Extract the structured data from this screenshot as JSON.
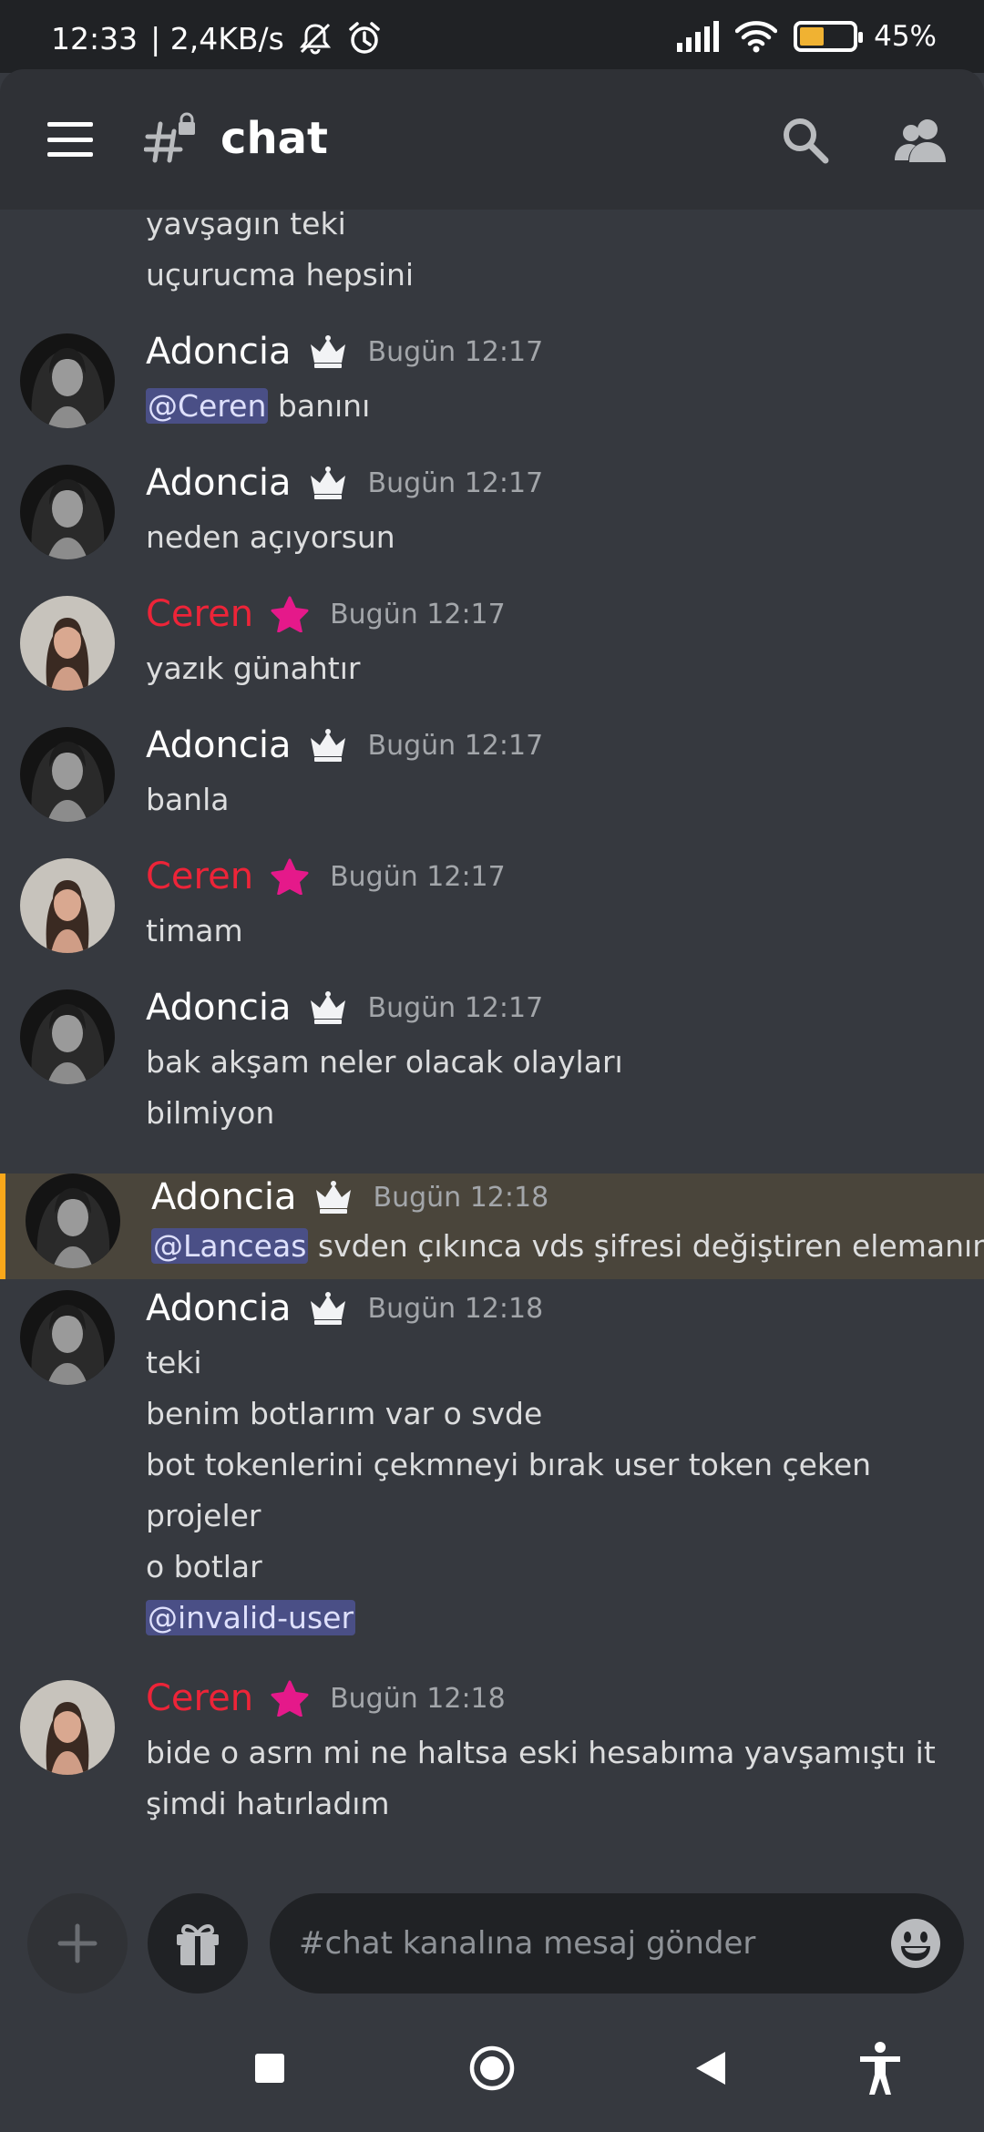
{
  "status_bar": {
    "time": "12:33",
    "network_speed": "| 2,4KB/s",
    "battery": "45%",
    "battery_level": 0.45
  },
  "header": {
    "channel_name": "chat",
    "icons": [
      "menu-icon",
      "locked-channel-hash-icon",
      "search-icon",
      "members-icon"
    ]
  },
  "colors": {
    "background": "#36393f",
    "header": "#2f3136",
    "mention_bg": "#4a4f86",
    "highlight_bg": "#4a453b",
    "highlight_bar": "#faa81a",
    "ceren_name": "#ed2438",
    "star_badge": "#e5198a"
  },
  "messages": [
    {
      "continuation": true,
      "lines": [
        {
          "text": "yavşagın teki"
        },
        {
          "text": "uçurucma hepsini"
        }
      ]
    },
    {
      "author": "Adoncia",
      "badge": "crown-icon",
      "time": "Bugün 12:17",
      "lines": [
        {
          "mention": "@Ceren",
          "text": " banını"
        }
      ]
    },
    {
      "author": "Adoncia",
      "badge": "crown-icon",
      "time": "Bugün 12:17",
      "lines": [
        {
          "text": "neden açıyorsun"
        }
      ]
    },
    {
      "author": "Ceren",
      "badge": "star-icon",
      "time": "Bugün 12:17",
      "lines": [
        {
          "text": "yazık günahtır"
        }
      ]
    },
    {
      "author": "Adoncia",
      "badge": "crown-icon",
      "time": "Bugün 12:17",
      "lines": [
        {
          "text": "banla"
        }
      ]
    },
    {
      "author": "Ceren",
      "badge": "star-icon",
      "time": "Bugün 12:17",
      "lines": [
        {
          "text": "timam"
        }
      ]
    },
    {
      "author": "Adoncia",
      "badge": "crown-icon",
      "time": "Bugün 12:17",
      "lines": [
        {
          "text": "bak akşam neler olacak olayları"
        },
        {
          "text": "bilmiyon"
        }
      ]
    },
    {
      "author": "Adoncia",
      "badge": "crown-icon",
      "time": "Bugün 12:18",
      "highlighted": true,
      "lines": [
        {
          "mention": "@Lanceas",
          "text": " svden çıkınca vds şifresi değiştiren elemanın"
        }
      ]
    },
    {
      "author": "Adoncia",
      "badge": "crown-icon",
      "time": "Bugün 12:18",
      "lines": [
        {
          "text": "teki"
        },
        {
          "text": "benim botlarım var o svde"
        },
        {
          "text": "bot tokenlerini çekmneyi bırak user token çeken"
        },
        {
          "text": "projeler"
        },
        {
          "text": "o botlar"
        },
        {
          "mention": "@invalid-user"
        }
      ]
    },
    {
      "author": "Ceren",
      "badge": "star-icon",
      "time": "Bugün 12:18",
      "lines": [
        {
          "text": "bide o asrn mi ne haltsa eski hesabıma yavşamıştı it"
        },
        {
          "text": "şimdi hatırladım"
        }
      ]
    }
  ],
  "composer": {
    "placeholder": "#chat kanalına mesaj gönder",
    "icons": [
      "plus-icon",
      "gift-icon",
      "emoji-icon"
    ]
  },
  "nav_bar": {
    "icons": [
      "recents-square-icon",
      "home-circle-icon",
      "back-triangle-icon",
      "accessibility-icon"
    ]
  }
}
